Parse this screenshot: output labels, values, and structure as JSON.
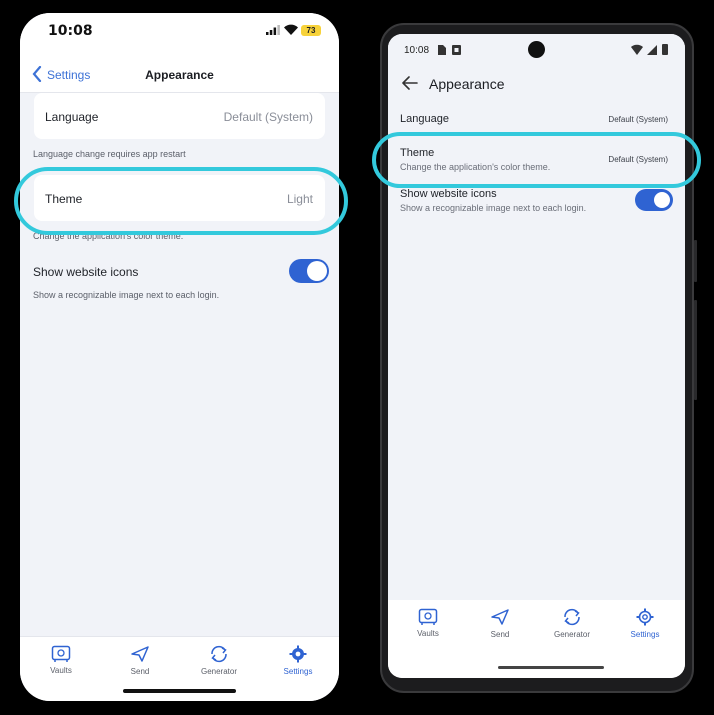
{
  "ios": {
    "status": {
      "time": "10:08",
      "battery": "73"
    },
    "nav": {
      "back_label": "Settings",
      "title": "Appearance"
    },
    "language": {
      "label": "Language",
      "value": "Default (System)",
      "hint": "Language change requires app restart"
    },
    "theme": {
      "label": "Theme",
      "value": "Light",
      "hint": "Change the application's color theme."
    },
    "website_icons": {
      "label": "Show website icons",
      "hint": "Show a recognizable image next to each login.",
      "enabled": true
    },
    "tabs": [
      {
        "label": "Vaults",
        "icon": "vault-icon"
      },
      {
        "label": "Send",
        "icon": "send-icon"
      },
      {
        "label": "Generator",
        "icon": "generator-icon"
      },
      {
        "label": "Settings",
        "icon": "gear-icon",
        "active": true
      }
    ]
  },
  "android": {
    "status": {
      "time": "10:08"
    },
    "appbar": {
      "title": "Appearance"
    },
    "language": {
      "label": "Language",
      "value": "Default (System)"
    },
    "theme": {
      "label": "Theme",
      "subtitle": "Change the application's color theme.",
      "value": "Default (System)"
    },
    "website_icons": {
      "label": "Show website icons",
      "subtitle": "Show a recognizable image next to each login.",
      "enabled": true
    },
    "tabs": [
      {
        "label": "Vaults",
        "icon": "vault-icon"
      },
      {
        "label": "Send",
        "icon": "send-icon"
      },
      {
        "label": "Generator",
        "icon": "generator-icon"
      },
      {
        "label": "Settings",
        "icon": "gear-icon",
        "active": true
      }
    ]
  },
  "colors": {
    "accent": "#2f63d2",
    "highlight": "#33c9dc",
    "background": "#f1f3f8"
  }
}
